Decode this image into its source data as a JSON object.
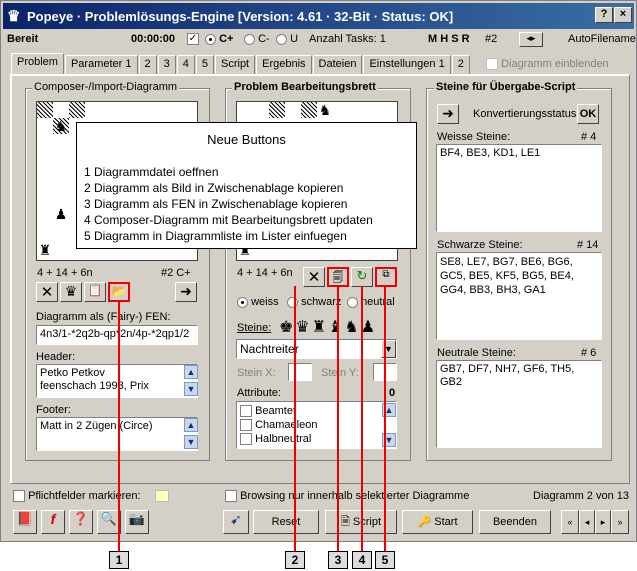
{
  "window": {
    "title": "Popeye · Problemlösungs-Engine [Version: 4.61 · 32-Bit · Status: OK]",
    "help_btn": "?",
    "close_btn": "×"
  },
  "statusbar": {
    "state": "Bereit",
    "time": "00:00:00",
    "radio_cplus": "C+",
    "radio_cminus": "C-",
    "radio_u": "U",
    "tasks": "Anzahl Tasks: 1",
    "mhsr": "M H S R",
    "goal": "#2",
    "autofilename": "AutoFilename"
  },
  "tabs": [
    "Problem",
    "Parameter 1",
    "2",
    "3",
    "4",
    "5",
    "Script",
    "Ergebnis",
    "Dateien",
    "Einstellungen 1",
    "2"
  ],
  "diagram_toggle": "Diagramm einblenden",
  "composer": {
    "title": "Composer-/Import-Diagramm",
    "count": "4 + 14 + 6n",
    "stip": "#2  C+",
    "fen_label": "Diagramm als (Fairy-) FEN:",
    "fen": "4n3/1-*2q2b-qp*2n/4p-*2qp1/2",
    "header_label": "Header:",
    "header_lines": [
      "Petko Petkov",
      "feenschach 1993, Prix"
    ],
    "footer_label": "Footer:",
    "footer": "Matt in 2 Zügen (Circe)"
  },
  "editor": {
    "title": "Problem Bearbeitungsbrett",
    "count": "4 + 14 + 6n",
    "color_white": "weiss",
    "color_black": "schwarz",
    "color_neutral": "neutral",
    "steine_label": "Steine:",
    "piece_select": "Nachtreiter",
    "stein_x": "Stein X:",
    "stein_y": "Stein Y:",
    "attr_label": "Attribute:",
    "attr_count": "0",
    "attributes": [
      "Beamtet",
      "Chamaeleon",
      "Halbneutral"
    ]
  },
  "script_panel": {
    "title": "Steine für Übergabe-Script",
    "conv_label": "Konvertierungsstatus:",
    "conv_value": "OK",
    "white_label": "Weisse Steine:",
    "white_count": "# 4",
    "white_text": "BF4, BE3, KD1, LE1",
    "black_label": "Schwarze Steine:",
    "black_count": "# 14",
    "black_text": "SE8, LE7, BG7, BE6, BG6, GC5, BE5, KF5, BG5, BE4, GG4, BB3, BH3, GA1",
    "neutral_label": "Neutrale Steine:",
    "neutral_count": "# 6",
    "neutral_text": "GB7, DF7, NH7, GF6, TH5, GB2"
  },
  "bottom": {
    "pflicht": "Pflichtfelder markieren:",
    "browsing": "Browsing nur innerhalb selektierter Diagramme",
    "diagram_pos": "Diagramm 2 von 13",
    "reset": "Reset",
    "script": "Script",
    "start": "Start",
    "beenden": "Beenden"
  },
  "popup": {
    "title": "Neue Buttons",
    "lines": [
      "1  Diagrammdatei oeffnen",
      "2  Diagramm als Bild in Zwischenablage kopieren",
      "3  Diagramm als FEN in Zwischenablage kopieren",
      "4  Composer-Diagramm mit Bearbeitungsbrett updaten",
      "5  Diagramm in Diagrammliste im Lister einfuegen"
    ]
  },
  "callouts": [
    "1",
    "2",
    "3",
    "4",
    "5"
  ]
}
